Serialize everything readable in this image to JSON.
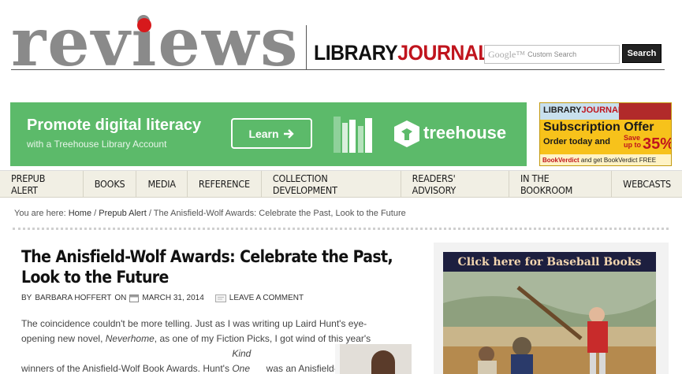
{
  "header": {
    "reviews_logo": "reviews",
    "lj_library": "LIBRARY",
    "lj_journal": "JOURNAL",
    "search": {
      "google_label": "Google™",
      "placeholder": "Custom Search",
      "button_label": "Search"
    }
  },
  "ads": {
    "treehouse": {
      "title": "Promote digital literacy",
      "subtitle": "with a Treehouse Library Account",
      "button_label": "Learn",
      "brand": "treehouse",
      "color": "#5cba6a"
    },
    "subscription": {
      "lj_library": "LIBRARY",
      "lj_journal": "JOURNAL",
      "headline": "Subscription Offer",
      "order": "Order today and",
      "save": "Save up to",
      "percent": "35%",
      "bottom_brand": "BookVerdict",
      "bottom_text": "and get BookVerdict FREE"
    },
    "baseball": {
      "banner": "Click here for Baseball Books"
    }
  },
  "nav": {
    "items": [
      "PREPUB ALERT",
      "BOOKS",
      "MEDIA",
      "REFERENCE",
      "COLLECTION DEVELOPMENT",
      "READERS' ADVISORY",
      "IN THE BOOKROOM",
      "WEBCASTS"
    ]
  },
  "breadcrumb": {
    "prefix": "You are here:",
    "home": "Home",
    "section": "Prepub Alert",
    "current": "The Anisfield-Wolf Awards: Celebrate the Past, Look to the Future"
  },
  "article": {
    "title": "The Anisfield-Wolf Awards: Celebrate the Past, Look to the Future",
    "byline_by": "BY",
    "author": "BARBARA HOFFERT",
    "byline_on": "ON",
    "date": "MARCH 31, 2014",
    "comment_link": "LEAVE A COMMENT",
    "body_1": "The coincidence couldn't be more telling. Just as I was writing up Laird Hunt's eye-opening new novel, ",
    "body_neverhome": "Neverhome",
    "body_2": ", as one of my Fiction Picks, I got wind of this year's winners of the Anisfield-Wolf Book Awards. Hunt's ",
    "body_kind_one": "Kind One",
    "body_3": " was an Anisfield-Wolf fiction winner last year, and one"
  }
}
